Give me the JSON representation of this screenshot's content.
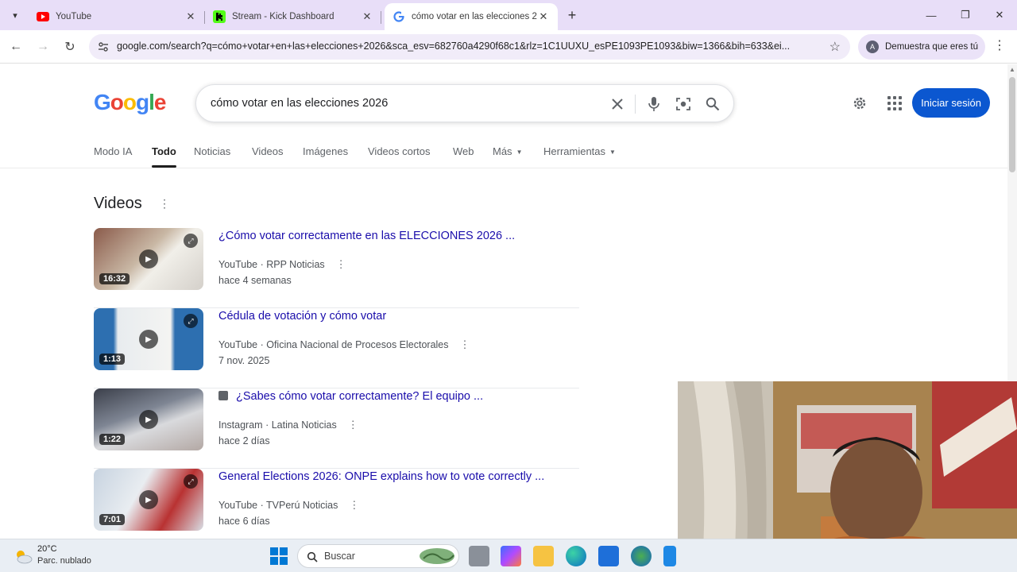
{
  "browser": {
    "tabs": [
      {
        "title": "YouTube",
        "icon": "youtube-icon",
        "active": false
      },
      {
        "title": "Stream - Kick Dashboard",
        "icon": "kick-icon",
        "active": false
      },
      {
        "title": "cómo votar en las elecciones 20",
        "icon": "google-icon",
        "active": true
      }
    ],
    "url": "google.com/search?q=cómo+votar+en+las+elecciones+2026&sca_esv=682760a4290f68c1&rlz=1C1UUXU_esPE1093PE1093&biw=1366&bih=633&ei...",
    "profile_label": "Demuestra que eres tú"
  },
  "google": {
    "logo": "Google",
    "query": "cómo votar en las elecciones 2026",
    "signin_label": "Iniciar sesión",
    "nav": [
      "Modo IA",
      "Todo",
      "Noticias",
      "Videos",
      "Imágenes",
      "Videos cortos",
      "Web",
      "Más",
      "Herramientas"
    ],
    "active_nav": "Todo"
  },
  "videos_section": {
    "title": "Videos",
    "items": [
      {
        "title": "¿Cómo votar correctamente en las ELECCIONES 2026 ...",
        "platform": "YouTube",
        "channel": "RPP Noticias",
        "date": "hace 4 semanas",
        "duration": "16:32",
        "short": false
      },
      {
        "title": "Cédula de votación y cómo votar",
        "platform": "YouTube",
        "channel": "Oficina Nacional de Procesos Electorales",
        "date": "7 nov. 2025",
        "duration": "1:13",
        "short": false
      },
      {
        "title": "¿Sabes cómo votar correctamente? El equipo ...",
        "platform": "Instagram",
        "channel": "Latina Noticias",
        "date": "hace 2 días",
        "duration": "1:22",
        "short": true
      },
      {
        "title": "General Elections 2026: ONPE explains how to vote correctly ...",
        "platform": "YouTube",
        "channel": "TVPerú Noticias",
        "date": "hace 6 días",
        "duration": "7:01",
        "short": false
      }
    ]
  },
  "taskbar": {
    "temperature": "20°C",
    "weather": "Parc. nublado",
    "search_placeholder": "Buscar"
  },
  "colors": {
    "accent": "#0b57d0",
    "link": "#1a0dab",
    "tabstrip": "#e8def8"
  }
}
